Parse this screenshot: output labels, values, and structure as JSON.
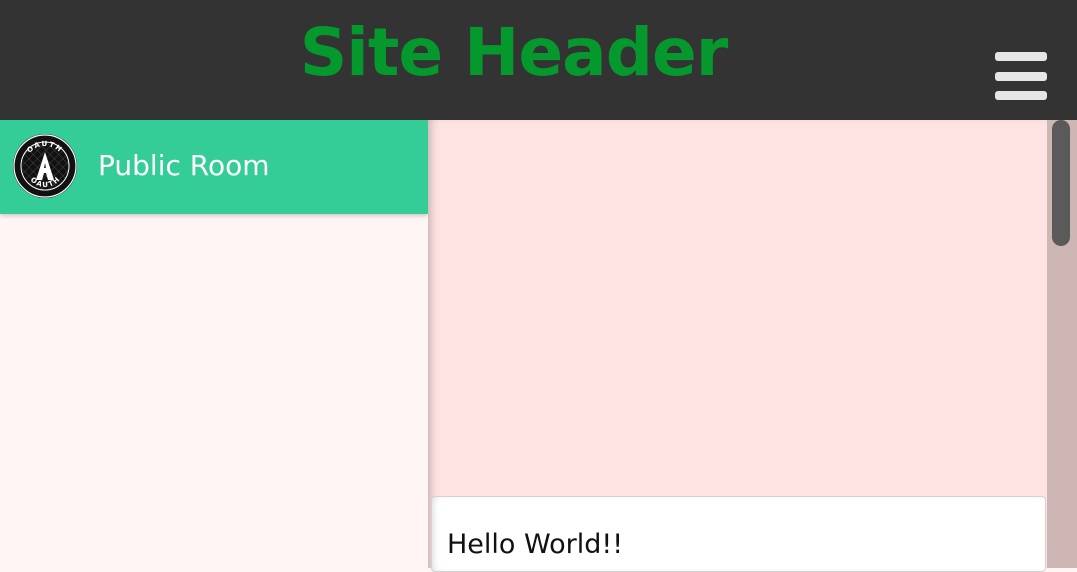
{
  "header": {
    "title": "Site Header",
    "title_color": "#05982d",
    "background": "#333333",
    "menu_icon": "hamburger-menu-icon"
  },
  "sidebar": {
    "rooms": [
      {
        "label": "Public Room",
        "avatar_icon": "oauth-logo-icon",
        "avatar_text": "OAUTH",
        "active_color": "#34cd97"
      }
    ]
  },
  "chat": {
    "background": "#ffe3e3",
    "input_value": "Hello World!!"
  }
}
